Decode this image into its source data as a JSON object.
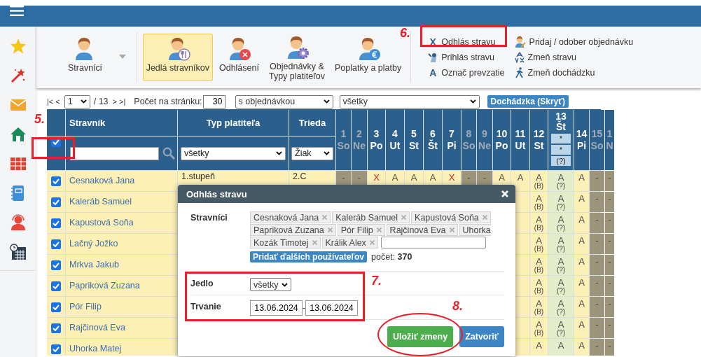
{
  "ribbon": {
    "items": [
      {
        "label": "Stravníci",
        "selected": false,
        "dropdown": true
      },
      {
        "label": "Jedlá stravníkov",
        "selected": true,
        "dropdown": false
      },
      {
        "label": "Odhlásení",
        "selected": false,
        "dropdown": false
      },
      {
        "label": "Objednávky &\nTypy platiteľov",
        "selected": false,
        "dropdown": false
      },
      {
        "label": "Poplatky a platby",
        "selected": false,
        "dropdown": false
      }
    ],
    "actions": [
      {
        "label": "Odhlás stravu",
        "icon": "X"
      },
      {
        "label": "Prihlás stravu"
      },
      {
        "label": "Označ prevzatie",
        "icon": "A"
      },
      {
        "label": "Pridaj / odober objednávku"
      },
      {
        "label": "Zmeň stravu"
      },
      {
        "label": "Zmeň dochádzku"
      }
    ]
  },
  "pager": {
    "first": "|<",
    "prev": "<",
    "page": "1",
    "total": "/ 13",
    "next": ">",
    "last": ">|",
    "per_page_label": "Počet na stránku:",
    "per_page": "30",
    "order_filter": "s objednávkou",
    "type_filter": "všetky",
    "attendance_button": "Dochádzka (Skryť)"
  },
  "table": {
    "select_all": {
      "checked": true
    },
    "name_header": "Stravník",
    "payer_header": "Typ platiteľa",
    "class_header": "Trieda",
    "payer_filter": "všetky",
    "class_filter": "Žiak",
    "days": [
      {
        "num": "1",
        "day": "So",
        "weekend": true,
        "selected": false
      },
      {
        "num": "2",
        "day": "Ne",
        "weekend": true,
        "selected": false
      },
      {
        "num": "3",
        "day": "Po",
        "weekend": false,
        "selected": false
      },
      {
        "num": "4",
        "day": "Ut",
        "weekend": false,
        "selected": false
      },
      {
        "num": "5",
        "day": "St",
        "weekend": false,
        "selected": false
      },
      {
        "num": "6",
        "day": "Št",
        "weekend": false,
        "selected": false
      },
      {
        "num": "7",
        "day": "Pi",
        "weekend": false,
        "selected": false
      },
      {
        "num": "8",
        "day": "So",
        "weekend": true,
        "selected": false
      },
      {
        "num": "9",
        "day": "Ne",
        "weekend": true,
        "selected": false
      },
      {
        "num": "10",
        "day": "Po",
        "weekend": false,
        "selected": false
      },
      {
        "num": "11",
        "day": "Ut",
        "weekend": false,
        "selected": false
      },
      {
        "num": "12",
        "day": "St",
        "weekend": false,
        "selected": false
      },
      {
        "num": "13",
        "day": "Št",
        "weekend": false,
        "selected": true,
        "filters": [
          "*",
          "*",
          "(?)"
        ]
      },
      {
        "num": "14",
        "day": "Pi",
        "weekend": false,
        "selected": false
      },
      {
        "num": "15",
        "day": "So",
        "weekend": true,
        "selected": false
      },
      {
        "num": "1",
        "day": "N",
        "weekend": true,
        "selected": false
      }
    ],
    "rows": [
      {
        "name": "Cesnaková Jana",
        "checked": true,
        "payer": "1.stupeň",
        "class": "2.C",
        "cells": [
          {
            "text": "-",
            "kind": "none"
          },
          {
            "text": "-",
            "kind": "none"
          },
          {
            "text": "X",
            "kind": "cancelled"
          },
          {
            "text": "A",
            "kind": "ordered"
          },
          {
            "text": "A",
            "kind": "ordered"
          },
          {
            "text": "A",
            "kind": "ordered"
          },
          {
            "text": "X",
            "kind": "cancelled"
          },
          {
            "text": "-",
            "kind": "none"
          },
          {
            "text": "-",
            "kind": "none"
          },
          {
            "text": "A",
            "kind": "ordered"
          },
          {
            "text": "A",
            "kind": "ordered"
          },
          {
            "text": "A",
            "note": "(B)",
            "kind": "ordered"
          },
          {
            "text": "A",
            "note": "(?)",
            "kind": "ordered"
          },
          {
            "text": "A",
            "kind": "ordered"
          },
          {
            "text": "-",
            "kind": "none"
          },
          {
            "text": "-",
            "kind": "none"
          }
        ]
      },
      {
        "name": "Kaleráb Samuel",
        "checked": true,
        "cells": [
          {
            "text": "A",
            "note": "(B)",
            "kind": "ordered"
          },
          {
            "text": "A",
            "note": "(?)",
            "kind": "ordered"
          },
          {
            "text": "A",
            "kind": "ordered"
          },
          {
            "text": "-",
            "kind": "none"
          },
          {
            "text": "-",
            "kind": "none"
          }
        ]
      },
      {
        "name": "Kapustová Soňa",
        "checked": true,
        "cells": [
          {
            "text": "A",
            "note": "(B)",
            "kind": "ordered"
          },
          {
            "text": "A",
            "note": "(?)",
            "kind": "ordered"
          },
          {
            "text": "A",
            "kind": "ordered"
          },
          {
            "text": "-",
            "kind": "none"
          },
          {
            "text": "-",
            "kind": "none"
          }
        ]
      },
      {
        "name": "Lačný Jožko",
        "checked": true,
        "cells": [
          {
            "text": "A",
            "note": "(B)",
            "kind": "ordered"
          },
          {
            "text": "A",
            "note": "(?)",
            "kind": "ordered"
          },
          {
            "text": "A",
            "kind": "ordered"
          },
          {
            "text": "-",
            "kind": "none"
          },
          {
            "text": "-",
            "kind": "none"
          }
        ]
      },
      {
        "name": "Mrkva Jakub",
        "checked": true,
        "cells": [
          {
            "text": "A",
            "note": "(B)",
            "kind": "ordered"
          },
          {
            "text": "A",
            "note": "(?)",
            "kind": "ordered"
          },
          {
            "text": "A",
            "kind": "ordered"
          },
          {
            "text": "-",
            "kind": "none"
          },
          {
            "text": "-",
            "kind": "none"
          }
        ]
      },
      {
        "name": "Papriková Zuzana",
        "checked": true,
        "cells": [
          {
            "text": "A",
            "note": "(B)",
            "kind": "ordered"
          },
          {
            "text": "A",
            "note": "(?)",
            "kind": "ordered"
          },
          {
            "text": "A",
            "kind": "ordered"
          },
          {
            "text": "-",
            "kind": "none"
          },
          {
            "text": "-",
            "kind": "none"
          }
        ]
      },
      {
        "name": "Pór Filip",
        "checked": true,
        "cells": [
          {
            "text": "A",
            "note": "(B)",
            "kind": "ordered"
          },
          {
            "text": "A",
            "note": "(?)",
            "kind": "ordered"
          },
          {
            "text": "A",
            "kind": "ordered"
          },
          {
            "text": "-",
            "kind": "none"
          },
          {
            "text": "-",
            "kind": "none"
          }
        ]
      },
      {
        "name": "Rajčinová Eva",
        "checked": true,
        "cells": [
          {
            "text": "A",
            "note": "(B)",
            "kind": "ordered"
          },
          {
            "text": "A",
            "note": "(?)",
            "kind": "ordered"
          },
          {
            "text": "A",
            "kind": "ordered"
          },
          {
            "text": "-",
            "kind": "none"
          },
          {
            "text": "-",
            "kind": "none"
          }
        ]
      },
      {
        "name": "Uhorka Matej",
        "checked": true,
        "cells": [
          {
            "text": "A",
            "kind": "ordered"
          },
          {
            "text": "A",
            "kind": "ordered"
          },
          {
            "text": "A",
            "kind": "ordered"
          },
          {
            "text": "-",
            "kind": "none"
          },
          {
            "text": "-",
            "kind": "none"
          }
        ]
      }
    ]
  },
  "modal": {
    "title": "Odhlás stravu",
    "diners_label": "Stravníci",
    "diner_lines": [
      [
        {
          "name": "Cesnaková Jana"
        },
        {
          "name": "Kaleráb Samuel"
        },
        {
          "name": "Kapustová Soňa"
        }
      ],
      [
        {
          "name": "Papriková Zuzana"
        },
        {
          "name": "Pór Filip"
        },
        {
          "name": "Rajčinová Eva"
        },
        {
          "name": "Uhorka",
          "clipped": true
        }
      ],
      [
        {
          "name": "Kozák Timotej"
        },
        {
          "name": "Králik Alex"
        }
      ]
    ],
    "add_button": "Pridať ďalších používateľov",
    "count": "počet: **370**",
    "meal_label": "Jedlo",
    "meal": "všetky",
    "duration_label": "Trvanie",
    "date_from": "13.06.2024",
    "date_separator": "-",
    "date_to": "13.06.2024",
    "buttons": [
      {
        "label": "Uložiť zmeny",
        "kind": "primary"
      },
      {
        "label": "Zatvoriť",
        "kind": "secondary"
      }
    ]
  },
  "annotations": [
    {
      "label": "5.",
      "kind": "rect"
    },
    {
      "label": "6.",
      "kind": "rect"
    },
    {
      "label": "7.",
      "kind": "rect"
    },
    {
      "label": "8.",
      "kind": "ellipse"
    }
  ]
}
